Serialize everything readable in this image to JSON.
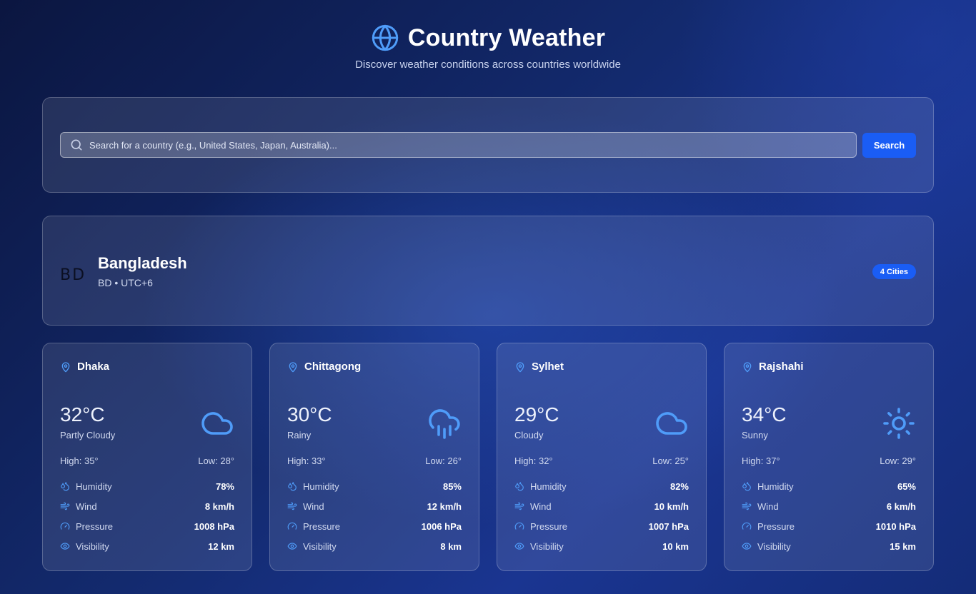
{
  "header": {
    "title": "Country Weather",
    "subtitle": "Discover weather conditions across countries worldwide",
    "icon": "globe-icon"
  },
  "search": {
    "placeholder": "Search for a country (e.g., United States, Japan, Australia)...",
    "value": "",
    "button_label": "Search"
  },
  "country": {
    "flag_text": "BD",
    "name": "Bangladesh",
    "meta": "BD • UTC+6",
    "cities_badge": "4 Cities"
  },
  "colors": {
    "accent": "#1a5df5",
    "icon_blue": "#4f9cf9"
  },
  "stat_labels": {
    "humidity": "Humidity",
    "wind": "Wind",
    "pressure": "Pressure",
    "visibility": "Visibility"
  },
  "cities": [
    {
      "name": "Dhaka",
      "temp": "32°C",
      "condition": "Partly Cloudy",
      "icon": "cloud-icon",
      "high": "High: 35°",
      "low": "Low: 28°",
      "humidity": "78%",
      "wind": "8 km/h",
      "pressure": "1008 hPa",
      "visibility": "12 km"
    },
    {
      "name": "Chittagong",
      "temp": "30°C",
      "condition": "Rainy",
      "icon": "rain-cloud-icon",
      "high": "High: 33°",
      "low": "Low: 26°",
      "humidity": "85%",
      "wind": "12 km/h",
      "pressure": "1006 hPa",
      "visibility": "8 km"
    },
    {
      "name": "Sylhet",
      "temp": "29°C",
      "condition": "Cloudy",
      "icon": "cloud-icon",
      "high": "High: 32°",
      "low": "Low: 25°",
      "humidity": "82%",
      "wind": "10 km/h",
      "pressure": "1007 hPa",
      "visibility": "10 km"
    },
    {
      "name": "Rajshahi",
      "temp": "34°C",
      "condition": "Sunny",
      "icon": "sun-icon",
      "high": "High: 37°",
      "low": "Low: 29°",
      "humidity": "65%",
      "wind": "6 km/h",
      "pressure": "1010 hPa",
      "visibility": "15 km"
    }
  ]
}
